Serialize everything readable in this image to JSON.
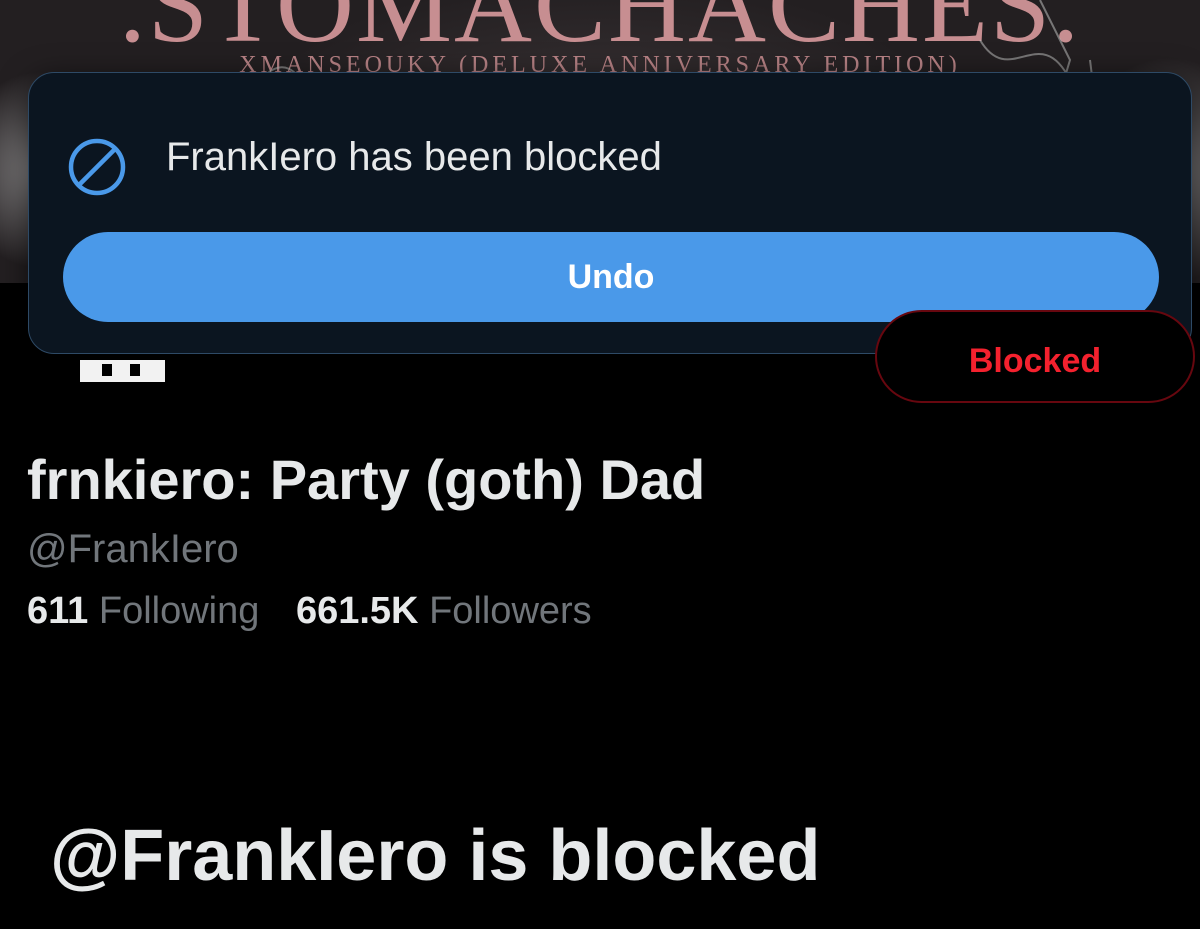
{
  "banner": {
    "title": ".STOMACHACHES.",
    "subtitle": "XMANSEOUKY (DELUXE ANNIVERSARY EDITION)"
  },
  "toast": {
    "icon": "block-icon",
    "message": "FrankIero has been blocked",
    "undo_label": "Undo"
  },
  "profile": {
    "blocked_button_label": "Blocked",
    "display_name": "frnkiero: Party (goth) Dad",
    "handle": "@FrankIero",
    "following_count": "611",
    "following_label": "Following",
    "followers_count": "661.5K",
    "followers_label": "Followers"
  },
  "blocked_notice": "@FrankIero is blocked",
  "colors": {
    "accent": "#4a99e9",
    "danger": "#f4212e",
    "toast_bg": "#0b1520",
    "muted_text": "#71767b"
  }
}
